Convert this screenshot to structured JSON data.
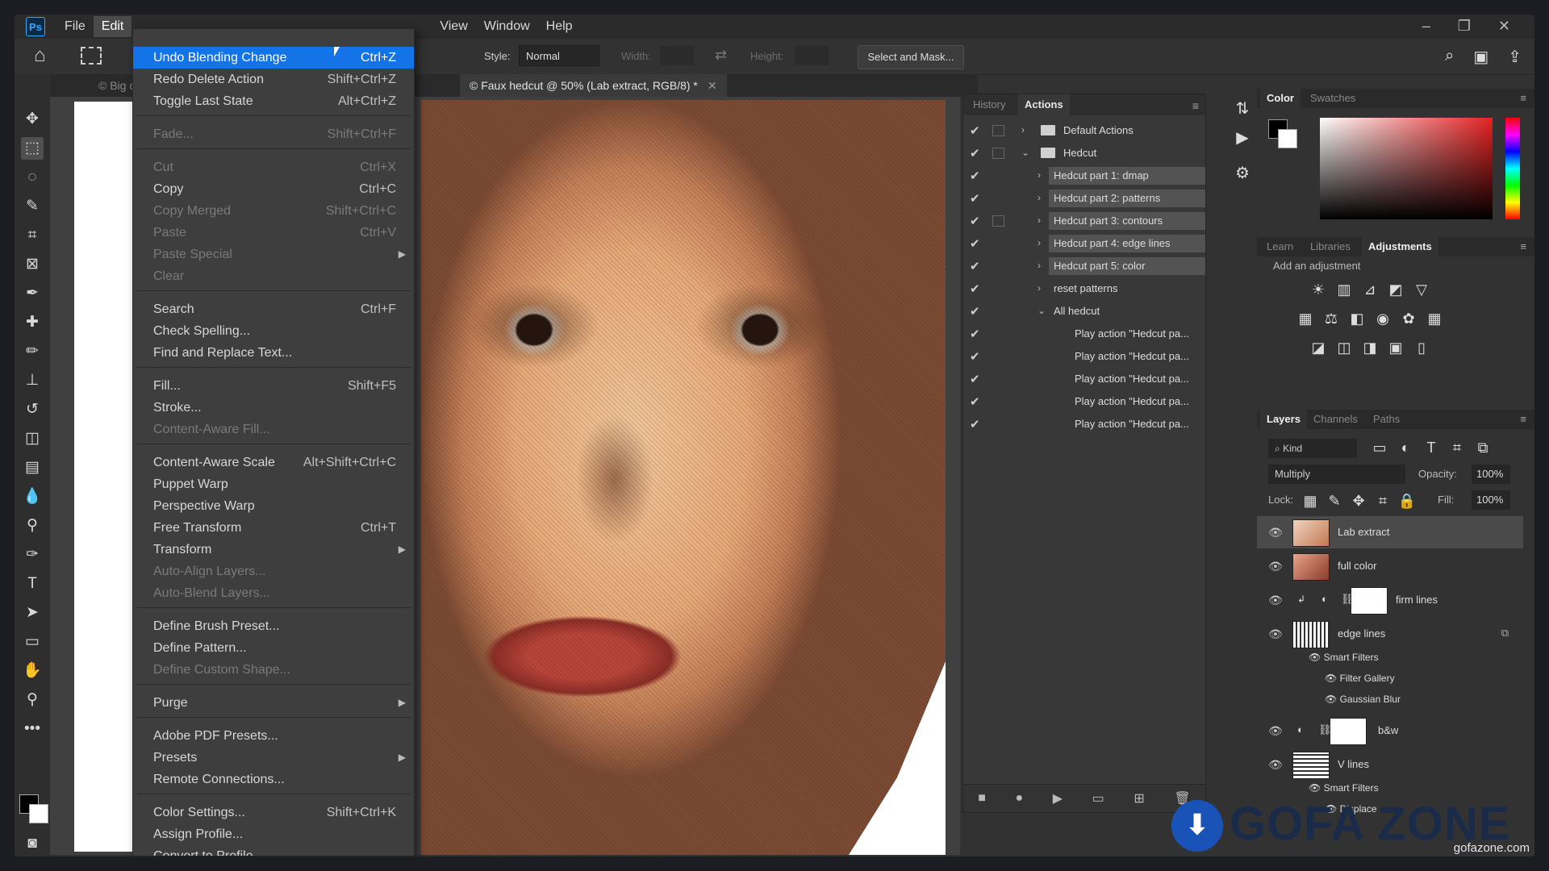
{
  "menubar": {
    "logo": "Ps",
    "items_left": [
      "File",
      "Edit"
    ],
    "items_right": [
      "View",
      "Window",
      "Help"
    ]
  },
  "options": {
    "style_label": "Style:",
    "style_value": "Normal",
    "width_label": "Width:",
    "height_label": "Height:",
    "select_mask_label": "Select and Mask..."
  },
  "doc_tabs": {
    "tab1": "© Big chee",
    "tab2": "© Faux hedcut @ 50% (Lab extract, RGB/8) *"
  },
  "edit_menu": {
    "undo": {
      "label": "Undo Blending Change",
      "shortcut": "Ctrl+Z"
    },
    "redo": {
      "label": "Redo Delete Action",
      "shortcut": "Shift+Ctrl+Z"
    },
    "toggle": {
      "label": "Toggle Last State",
      "shortcut": "Alt+Ctrl+Z"
    },
    "fade": {
      "label": "Fade...",
      "shortcut": "Shift+Ctrl+F"
    },
    "cut": {
      "label": "Cut",
      "shortcut": "Ctrl+X"
    },
    "copy": {
      "label": "Copy",
      "shortcut": "Ctrl+C"
    },
    "copy_merged": {
      "label": "Copy Merged",
      "shortcut": "Shift+Ctrl+C"
    },
    "paste": {
      "label": "Paste",
      "shortcut": "Ctrl+V"
    },
    "paste_special": {
      "label": "Paste Special"
    },
    "clear": {
      "label": "Clear"
    },
    "search": {
      "label": "Search",
      "shortcut": "Ctrl+F"
    },
    "check_spelling": {
      "label": "Check Spelling..."
    },
    "find_replace": {
      "label": "Find and Replace Text..."
    },
    "fill": {
      "label": "Fill...",
      "shortcut": "Shift+F5"
    },
    "stroke": {
      "label": "Stroke..."
    },
    "content_aware_fill": {
      "label": "Content-Aware Fill..."
    },
    "content_aware_scale": {
      "label": "Content-Aware Scale",
      "shortcut": "Alt+Shift+Ctrl+C"
    },
    "puppet_warp": {
      "label": "Puppet Warp"
    },
    "perspective_warp": {
      "label": "Perspective Warp"
    },
    "free_transform": {
      "label": "Free Transform",
      "shortcut": "Ctrl+T"
    },
    "transform": {
      "label": "Transform"
    },
    "auto_align": {
      "label": "Auto-Align Layers..."
    },
    "auto_blend": {
      "label": "Auto-Blend Layers..."
    },
    "define_brush": {
      "label": "Define Brush Preset..."
    },
    "define_pattern": {
      "label": "Define Pattern..."
    },
    "define_shape": {
      "label": "Define Custom Shape..."
    },
    "purge": {
      "label": "Purge"
    },
    "pdf_presets": {
      "label": "Adobe PDF Presets..."
    },
    "presets": {
      "label": "Presets"
    },
    "remote": {
      "label": "Remote Connections..."
    },
    "color_settings": {
      "label": "Color Settings...",
      "shortcut": "Shift+Ctrl+K"
    },
    "assign_profile": {
      "label": "Assign Profile..."
    },
    "convert_profile": {
      "label": "Convert to Profile..."
    }
  },
  "actions_panel": {
    "tab_history": "History",
    "tab_actions": "Actions",
    "rows": [
      "Default Actions",
      "Hedcut",
      "Hedcut part 1: dmap",
      "Hedcut part 2: patterns",
      "Hedcut part 3: contours",
      "Hedcut part 4: edge lines",
      "Hedcut part 5: color",
      "reset patterns",
      "All hedcut",
      "Play action \"Hedcut pa...",
      "Play action \"Hedcut pa...",
      "Play action \"Hedcut pa...",
      "Play action \"Hedcut pa...",
      "Play action \"Hedcut pa..."
    ]
  },
  "color_panel": {
    "tab_color": "Color",
    "tab_swatches": "Swatches"
  },
  "adjustments_panel": {
    "tab_learn": "Learn",
    "tab_libraries": "Libraries",
    "tab_adjustments": "Adjustments",
    "add_label": "Add an adjustment"
  },
  "layers_panel": {
    "tab_layers": "Layers",
    "tab_channels": "Channels",
    "tab_paths": "Paths",
    "kind": "Kind",
    "blend_mode": "Multiply",
    "opacity_label": "Opacity:",
    "opacity_value": "100%",
    "lock_label": "Lock:",
    "fill_label": "Fill:",
    "fill_value": "100%",
    "layers": [
      "Lab extract",
      "full color",
      "firm lines",
      "edge lines",
      "b&w",
      "V lines"
    ],
    "smart_filters": "Smart Filters",
    "filter_gallery": "Filter Gallery",
    "gaussian_blur": "Gaussian Blur",
    "smart_filters_2": "Smart Filters",
    "displace": "Displace"
  },
  "watermark": {
    "brand": "GOFA ZONE",
    "url": "gofazone.com"
  }
}
